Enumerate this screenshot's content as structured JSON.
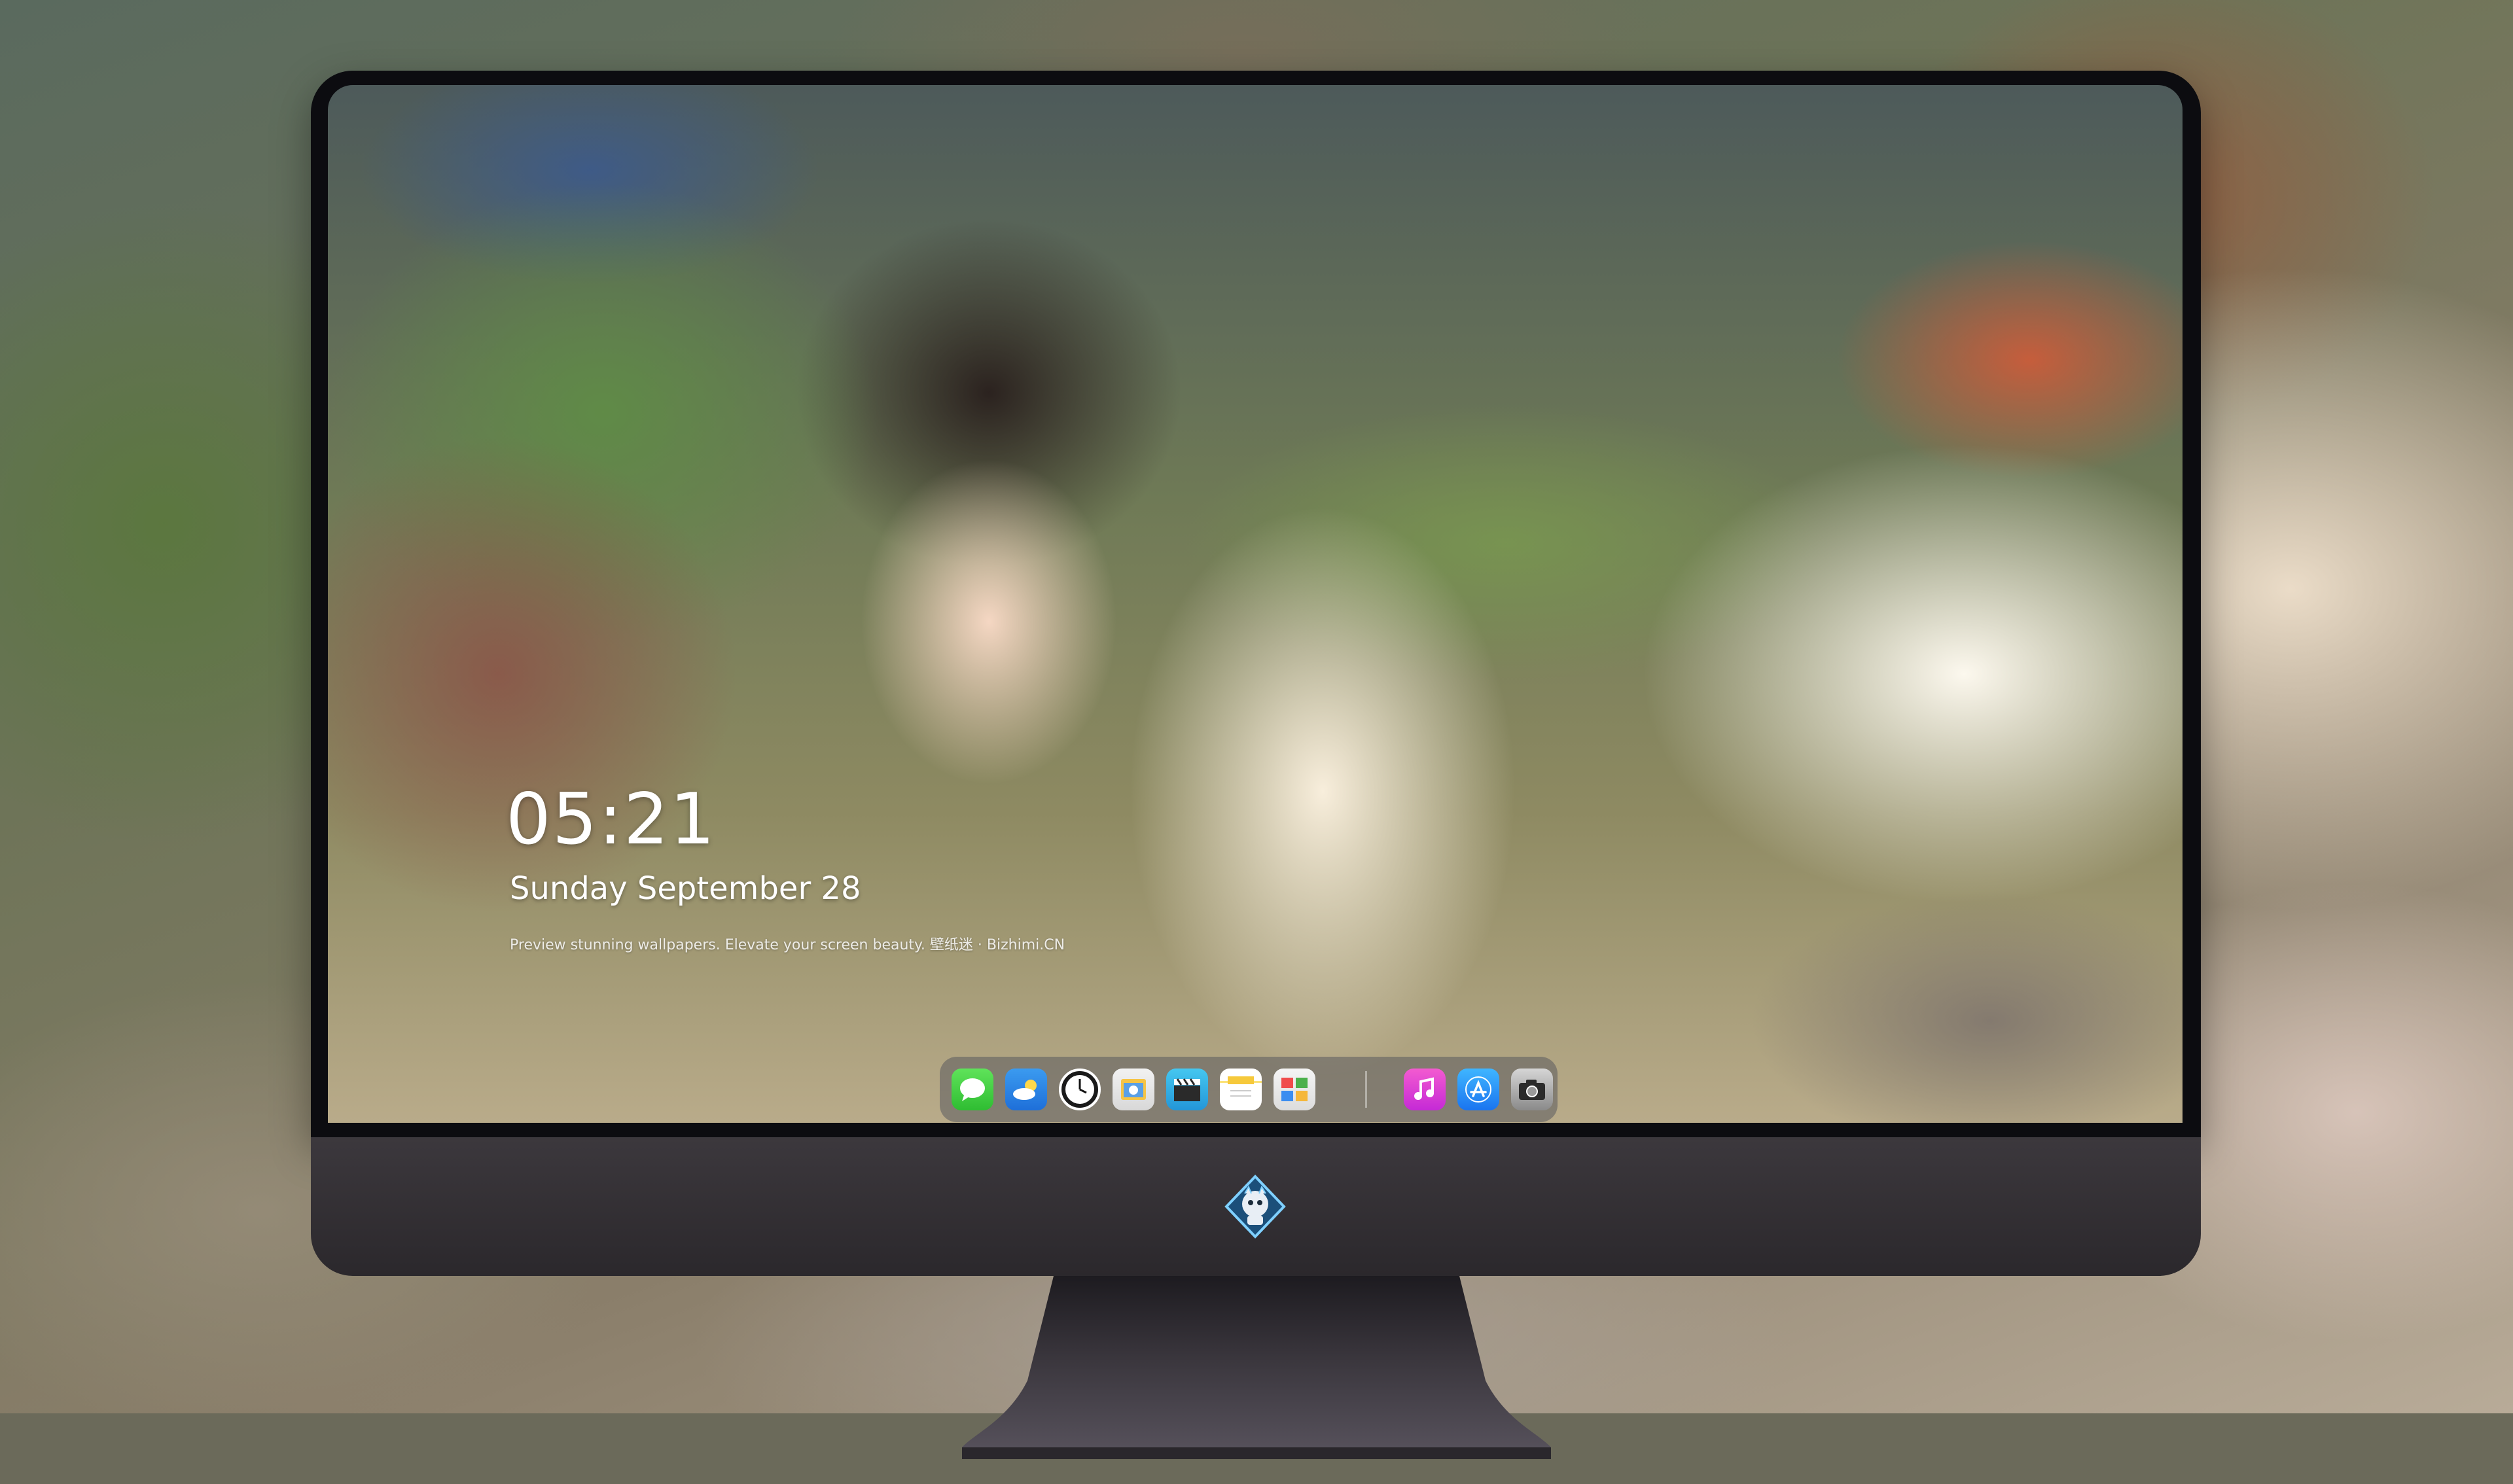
{
  "lockscreen": {
    "time": "05:21",
    "date": "Sunday September  28",
    "caption": "Preview stunning wallpapers. Elevate your screen beauty. 壁纸迷 · Bizhimi.CN"
  },
  "dock": {
    "items": [
      {
        "name": "Messages",
        "icon": "messages-icon"
      },
      {
        "name": "Weather",
        "icon": "weather-icon"
      },
      {
        "name": "Clock",
        "icon": "clock-icon"
      },
      {
        "name": "Preview",
        "icon": "preview-icon"
      },
      {
        "name": "Clips",
        "icon": "clapperboard-icon"
      },
      {
        "name": "Notes",
        "icon": "notes-icon"
      },
      {
        "name": "Photos",
        "icon": "photos-icon"
      },
      {
        "name": "Music",
        "icon": "music-note-icon"
      },
      {
        "name": "App Store",
        "icon": "app-store-icon"
      },
      {
        "name": "Camera",
        "icon": "camera-icon"
      }
    ]
  },
  "colors": {
    "bezel": "#0c0c10",
    "chin": "#36323a",
    "text": "#ffffff"
  }
}
